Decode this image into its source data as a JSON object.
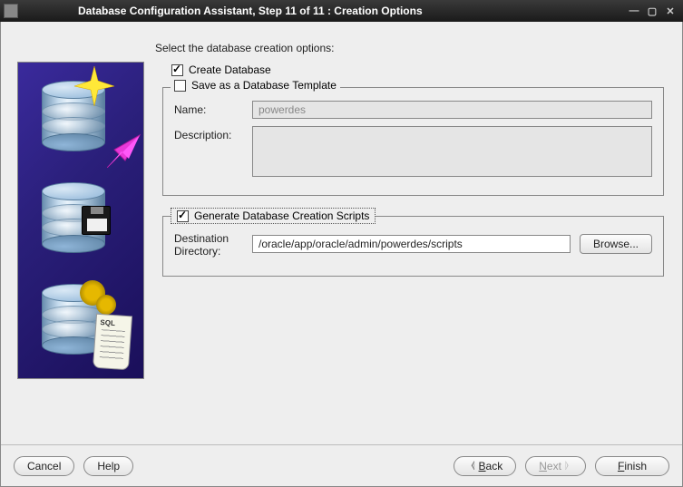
{
  "window": {
    "title": "Database Configuration Assistant, Step 11 of 11 : Creation Options"
  },
  "instruction": "Select the database creation options:",
  "create_db": {
    "label": "Create Database",
    "checked": true
  },
  "save_template": {
    "legend": "Save as a Database Template",
    "checked": false,
    "name_label": "Name:",
    "name_value": "powerdes",
    "desc_label": "Description:",
    "desc_value": ""
  },
  "gen_scripts": {
    "legend": "Generate Database Creation Scripts",
    "checked": true,
    "dir_label": "Destination\nDirectory:",
    "dir_value": "/oracle/app/oracle/admin/powerdes/scripts",
    "browse_label": "Browse..."
  },
  "buttons": {
    "cancel": "Cancel",
    "help": "Help",
    "back": "Back",
    "next": "Next",
    "finish": "Finish"
  }
}
